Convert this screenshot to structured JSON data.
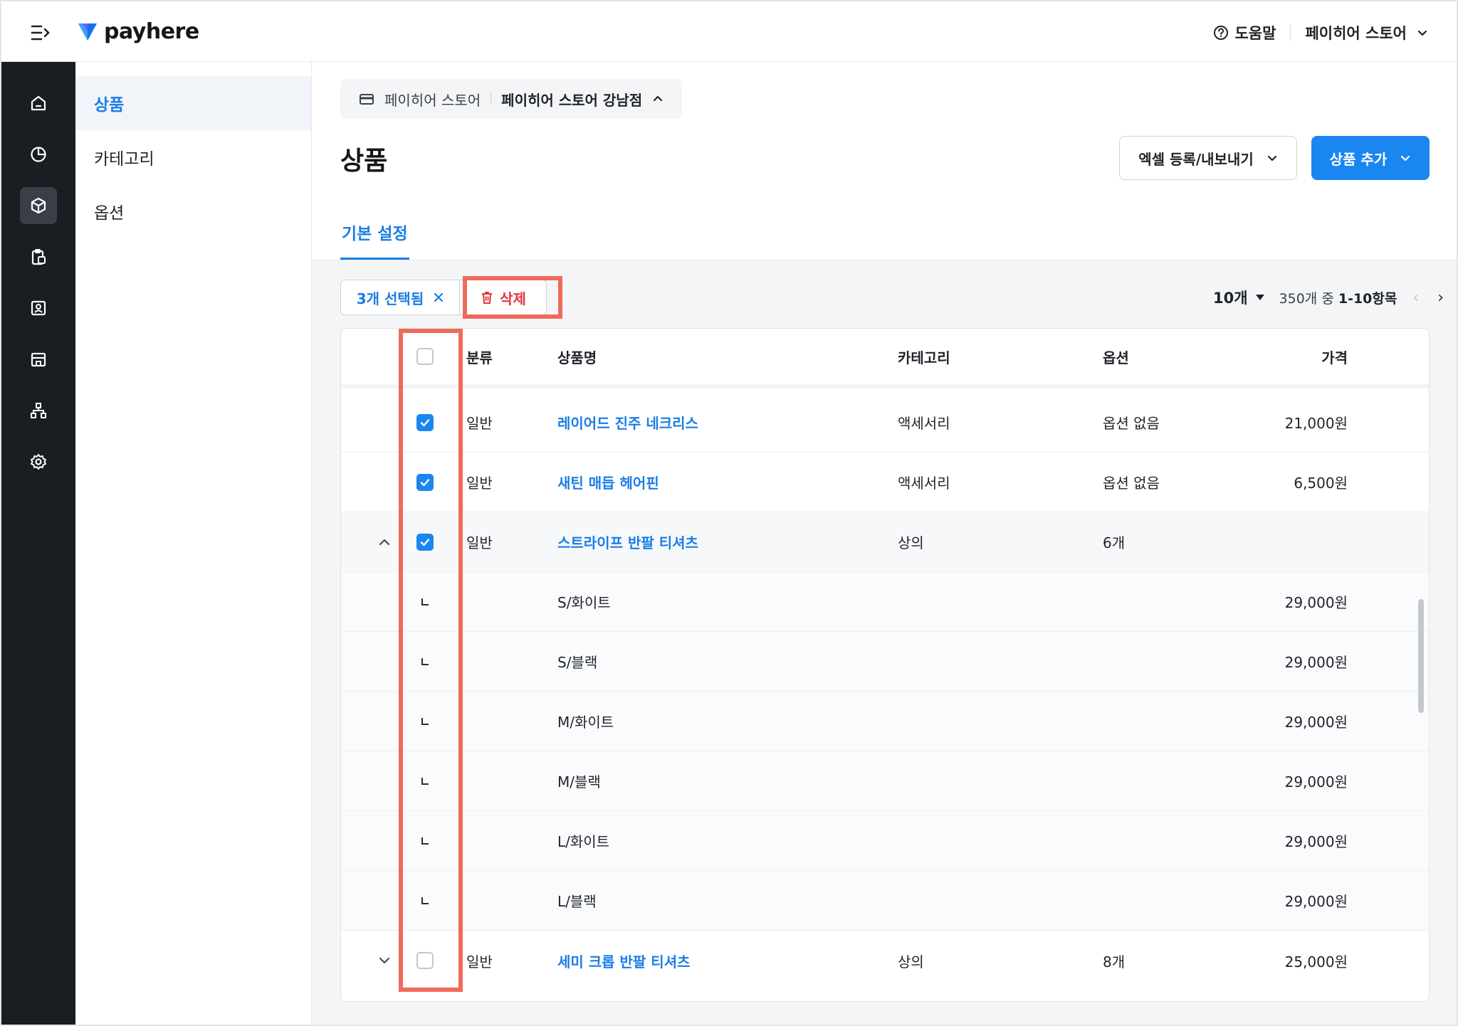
{
  "brand": {
    "name": "payhere"
  },
  "topbar": {
    "help_label": "도움말",
    "store_label": "페이히어 스토어"
  },
  "rail": {
    "items": [
      "home-icon",
      "chart-pie-icon",
      "box-icon",
      "clipboard-icon",
      "contact-icon",
      "store-icon",
      "org-chart-icon",
      "gear-icon"
    ],
    "active": "box-icon"
  },
  "subnav": {
    "items": [
      {
        "label": "상품",
        "active": true
      },
      {
        "label": "카테고리"
      },
      {
        "label": "옵션"
      }
    ]
  },
  "breadcrumb": {
    "store": "페이히어 스토어",
    "branch": "페이히어 스토어 강남점"
  },
  "page": {
    "title": "상품",
    "excel_button": "엑셀 등록/내보내기",
    "add_button": "상품 추가",
    "tab": "기본 설정"
  },
  "toolbar": {
    "selected_label": "3개 선택됨",
    "delete_label": "삭제"
  },
  "pager": {
    "page_size": "10개",
    "range_prefix": "350개 중 ",
    "range": "1-10항목"
  },
  "table": {
    "columns": {
      "type": "분류",
      "name": "상품명",
      "category": "카테고리",
      "option": "옵션",
      "price": "가격"
    },
    "rows": [
      {
        "type": "일반",
        "name": "레이어드 진주 네크리스",
        "category": "액세서리",
        "option": "옵션 없음",
        "price": "21,000원",
        "checked": true
      },
      {
        "type": "일반",
        "name": "새틴 매듭 헤어핀",
        "category": "액세서리",
        "option": "옵션 없음",
        "price": "6,500원",
        "checked": true
      },
      {
        "type": "일반",
        "name": "스트라이프 반팔 티셔츠",
        "category": "상의",
        "option": "6개",
        "price": "",
        "checked": true,
        "expanded": true
      },
      {
        "sub": true,
        "name": "S/화이트",
        "price": "29,000원"
      },
      {
        "sub": true,
        "name": "S/블랙",
        "price": "29,000원"
      },
      {
        "sub": true,
        "name": "M/화이트",
        "price": "29,000원"
      },
      {
        "sub": true,
        "name": "M/블랙",
        "price": "29,000원"
      },
      {
        "sub": true,
        "name": "L/화이트",
        "price": "29,000원"
      },
      {
        "sub": true,
        "name": "L/블랙",
        "price": "29,000원"
      },
      {
        "type": "일반",
        "name": "세미 크롭 반팔 티셔츠",
        "category": "상의",
        "option": "8개",
        "price": "25,000원",
        "checked": false,
        "collapsed": true
      }
    ]
  },
  "colors": {
    "accent": "#1a86f0",
    "danger": "#e5343b",
    "highlight": "#ef6a5a",
    "rail_bg": "#1a1d22"
  }
}
